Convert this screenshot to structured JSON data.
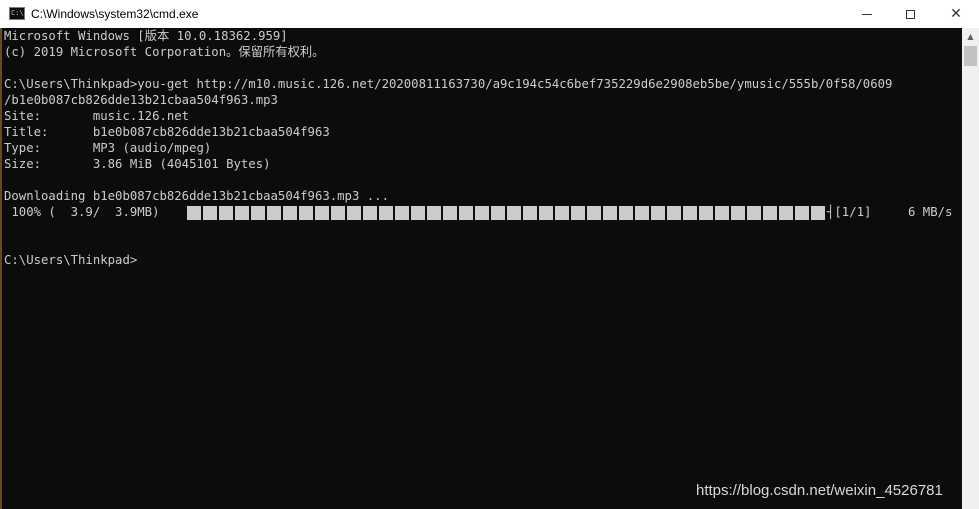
{
  "window": {
    "title": "C:\\Windows\\system32\\cmd.exe",
    "app_icon_label": "C:\\",
    "minimize_icon": "minimize-icon",
    "maximize_icon": "maximize-icon",
    "close_glyph": "✕"
  },
  "console": {
    "lines": [
      "Microsoft Windows [版本 10.0.18362.959]",
      "(c) 2019 Microsoft Corporation。保留所有权利。",
      "",
      "C:\\Users\\Thinkpad>you-get http://m10.music.126.net/20200811163730/a9c194c54c6bef735229d6e2908eb5be/ymusic/555b/0f58/0609",
      "/b1e0b087cb826dde13b21cbaa504f963.mp3",
      "Site:       music.126.net",
      "Title:      b1e0b087cb826dde13b21cbaa504f963",
      "Type:       MP3 (audio/mpeg)",
      "Size:       3.86 MiB (4045101 Bytes)",
      "",
      "Downloading b1e0b087cb826dde13b21cbaa504f963.mp3 ..."
    ],
    "progress": {
      "label": " 100% (  3.9/  3.9MB)",
      "percent": 100,
      "end": "┤[1/1]",
      "rate": "6 MB/s"
    },
    "prompt": "C:\\Users\\Thinkpad>"
  },
  "watermark": "https://blog.csdn.net/weixin_4526781"
}
